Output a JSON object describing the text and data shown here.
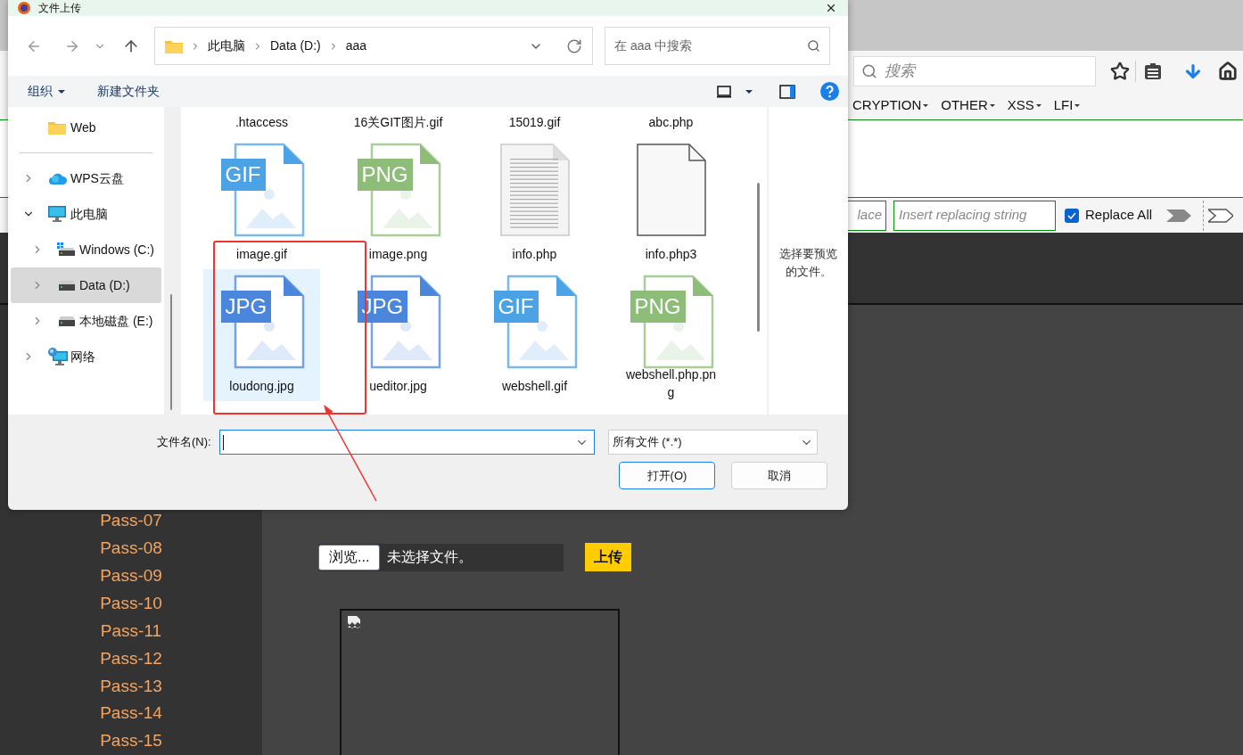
{
  "browser": {
    "search_placeholder": "搜索",
    "menu": [
      "CRYPTION",
      "OTHER",
      "XSS",
      "LFI"
    ],
    "replace": {
      "find_placeholder": "lace",
      "replace_placeholder": "Insert replacing string",
      "replace_all": {
        "label": "Replace All",
        "checked": true
      }
    },
    "sidebar_links": [
      "Pass-07",
      "Pass-08",
      "Pass-09",
      "Pass-10",
      "Pass-11",
      "Pass-12",
      "Pass-13",
      "Pass-14",
      "Pass-15"
    ],
    "upload": {
      "browse_button": "浏览...",
      "file_status": "未选择文件。",
      "submit_button": "上传"
    }
  },
  "dialog": {
    "title": "文件上传",
    "breadcrumb": [
      "此电脑",
      "Data (D:)",
      "aaa"
    ],
    "search_placeholder": "在 aaa 中搜索",
    "toolbar": [
      {
        "label": "组织",
        "menu": true
      },
      {
        "label": "新建文件夹",
        "menu": false
      }
    ],
    "nav": [
      {
        "label": "Web",
        "kind": "folder",
        "selected": false
      },
      {
        "label": "WPS云盘",
        "kind": "cloud",
        "expanded": false,
        "selected": false,
        "divider_before": true
      },
      {
        "label": "此电脑",
        "kind": "pc",
        "expanded": true,
        "selected": false,
        "children": [
          {
            "label": "Windows (C:)",
            "kind": "system-drive",
            "expanded": false,
            "selected": false
          },
          {
            "label": "Data (D:)",
            "kind": "drive",
            "expanded": false,
            "selected": true
          },
          {
            "label": "本地磁盘 (E:)",
            "kind": "drive",
            "expanded": false,
            "selected": false
          }
        ]
      },
      {
        "label": "网络",
        "kind": "network",
        "expanded": false,
        "selected": false
      }
    ],
    "files": [
      {
        "name": ".htaccess",
        "selected": false
      },
      {
        "name": "16关GIT图片.gif",
        "selected": false
      },
      {
        "name": "15019.gif",
        "selected": false
      },
      {
        "name": "abc.php",
        "selected": false
      },
      {
        "name": "image.gif",
        "kind": "image",
        "badge": "GIF",
        "color": "#4ba3e6",
        "selected": false
      },
      {
        "name": "image.png",
        "kind": "image",
        "badge": "PNG",
        "color": "#8dbd78",
        "selected": false
      },
      {
        "name": "info.php",
        "kind": "text",
        "selected": false
      },
      {
        "name": "info.php3",
        "kind": "blank",
        "selected": false
      },
      {
        "name": "loudong.jpg",
        "kind": "image",
        "badge": "JPG",
        "color": "#4a86dc",
        "selected": true
      },
      {
        "name": "ueditor.jpg",
        "kind": "image",
        "badge": "JPG",
        "color": "#4a86dc",
        "selected": false
      },
      {
        "name": "webshell.gif",
        "kind": "image",
        "badge": "GIF",
        "color": "#4ba3e6",
        "selected": false
      },
      {
        "name": "webshell.php.png",
        "kind": "image",
        "badge": "PNG",
        "color": "#8dbd78",
        "selected": false
      }
    ],
    "preview_hint": "选择要预览的文件。",
    "file_name_label": "文件名(N):",
    "file_type": "所有文件 (*.*)",
    "buttons": [
      {
        "label": "打开(O)",
        "default": true
      },
      {
        "label": "取消",
        "default": false
      }
    ]
  }
}
